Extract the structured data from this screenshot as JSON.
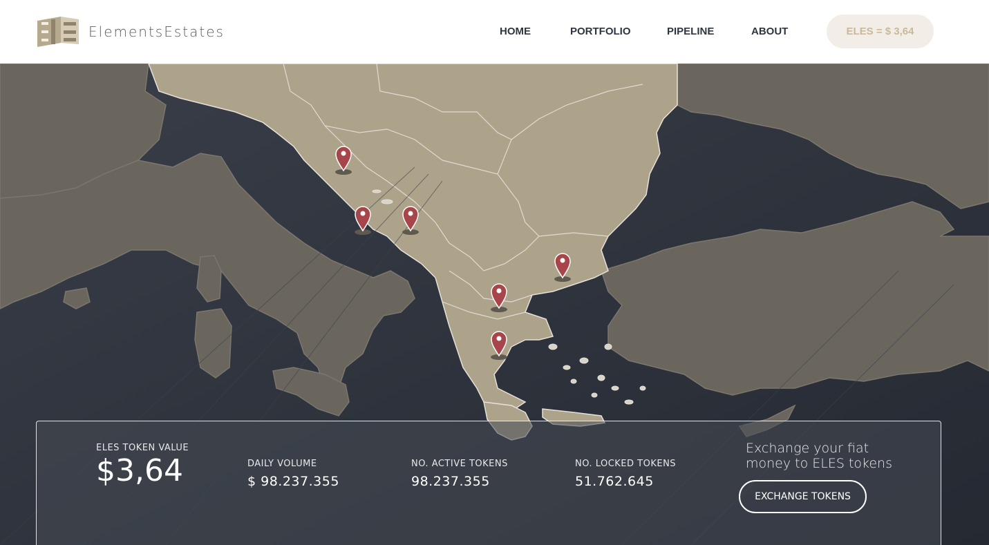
{
  "brand": {
    "name": "ElementsEstates",
    "logo_colors": [
      "#a79a7d",
      "#d2c8b1",
      "#8c806a"
    ]
  },
  "nav": {
    "items": [
      {
        "label": "HOME"
      },
      {
        "label": "PORTFOLIO"
      },
      {
        "label": "PIPELINE"
      },
      {
        "label": "ABOUT"
      }
    ],
    "price_badge": "ELES = $ 3,64"
  },
  "map": {
    "land_color": "#aba08a",
    "sea_color": "#2b2f39",
    "marker_color": "#a8454a",
    "marker_icon": "map-pin-icon"
  },
  "stats": {
    "token_value_label": "ELES TOKEN VALUE",
    "token_value": "$3,64",
    "daily_volume_label": "DAILY VOLUME",
    "daily_volume": "$ 98.237.355",
    "active_tokens_label": "NO. ACTIVE TOKENS",
    "active_tokens": "98.237.355",
    "locked_tokens_label": "NO. LOCKED TOKENS",
    "locked_tokens": "51.762.645"
  },
  "exchange": {
    "text": "Exchange your fiat money to ELES tokens",
    "button_label": "EXCHANGE TOKENS"
  }
}
